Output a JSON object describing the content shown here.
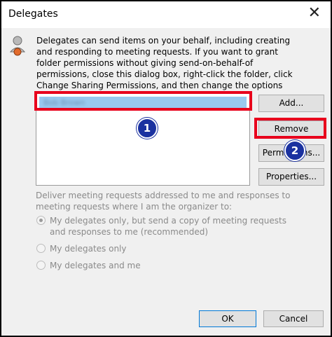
{
  "window": {
    "title": "Delegates",
    "close_glyph": "✕"
  },
  "description": "Delegates can send items on your behalf, including creating and responding to meeting requests. If you want to grant folder permissions without giving send-on-behalf-of permissions, close this dialog box, right-click the folder, click Change Sharing Permissions, and then change the options on the Permissions tab.",
  "delegates_list": {
    "items": [
      "Bob Brown"
    ]
  },
  "buttons": {
    "add": "Add...",
    "remove": "Remove",
    "permissions": "Permissions...",
    "properties": "Properties...",
    "ok": "OK",
    "cancel": "Cancel"
  },
  "deliver_label": "Deliver meeting requests addressed to me and responses to meeting requests where I am the organizer to:",
  "radio_options": [
    {
      "label": "My delegates only, but send a copy of meeting requests and responses to me (recommended)",
      "checked": true
    },
    {
      "label": "My delegates only",
      "checked": false
    },
    {
      "label": "My delegates and me",
      "checked": false
    }
  ],
  "annotations": {
    "step1": "1",
    "step2": "2",
    "highlight_color": "#e8001c",
    "badge_color": "#1a31a0"
  },
  "icons": {
    "delegates": "person-icon",
    "close": "close-icon"
  }
}
